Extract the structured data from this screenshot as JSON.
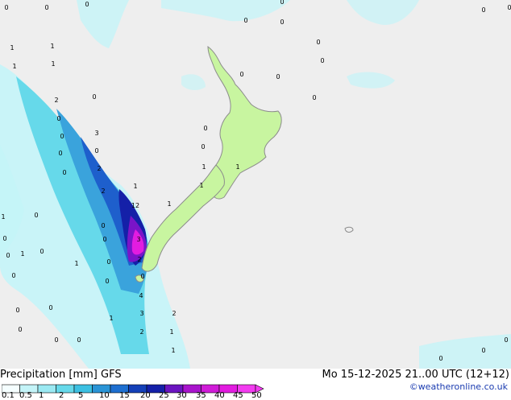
{
  "map": {
    "title": "Precipitation [mm]",
    "model": "GFS",
    "valid_time": "Mo 15-12-2025 21..00 UTC (12+12)",
    "credit": "©weatheronline.co.uk",
    "colors": {
      "background": "#eeeeee",
      "land": "#c8f5a0",
      "coast": "#8c8c8c",
      "precip_light": "#c4f4f8",
      "precip_mid": "#66d9ea",
      "precip_blue": "#3aa3dc",
      "precip_dark": "#1e5fcc",
      "precip_navy": "#1420a8",
      "precip_violet": "#7a14c8",
      "precip_magenta": "#e21ce0"
    },
    "point_labels": [
      "0",
      "0",
      "0",
      "0",
      "0",
      "0",
      "0",
      "0",
      "1",
      "1",
      "1",
      "1",
      "2",
      "0",
      "0",
      "0",
      "0",
      "0",
      "0",
      "0",
      "3",
      "0",
      "0",
      "0",
      "0",
      "0",
      "0",
      "1",
      "1",
      "2",
      "2",
      "12",
      "1",
      "1",
      "1",
      "1",
      "0",
      "0",
      "0",
      "3",
      "2",
      "0",
      "1",
      "1",
      "0",
      "0",
      "0",
      "0",
      "0",
      "0",
      "4",
      "3",
      "2",
      "2",
      "1",
      "1",
      "1",
      "0",
      "0",
      "0",
      "0",
      "0",
      "0",
      "0",
      "0"
    ],
    "legend": {
      "ticks": [
        "0.1",
        "0.5",
        "1",
        "2",
        "5",
        "10",
        "15",
        "20",
        "25",
        "30",
        "35",
        "40",
        "45",
        "50"
      ],
      "colors": [
        "#f5feff",
        "#c4f4f8",
        "#9be9f2",
        "#66d9ea",
        "#3cc0e2",
        "#2a94d6",
        "#1e6fd0",
        "#1440b8",
        "#1420a8",
        "#6b14c0",
        "#a814cc",
        "#d01cd8",
        "#e21ce0",
        "#f23cf0"
      ]
    }
  }
}
